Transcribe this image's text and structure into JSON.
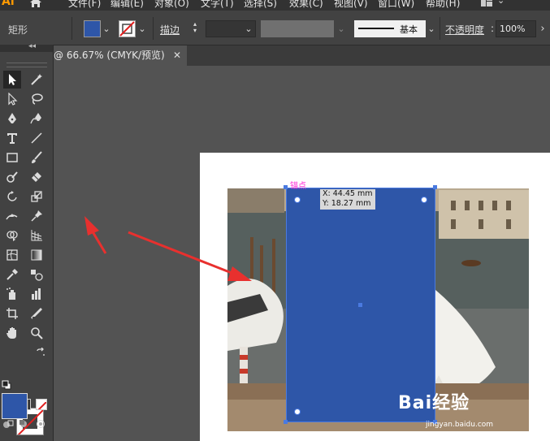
{
  "app": {
    "logo": "Ai"
  },
  "menu": [
    "文件(F)",
    "编辑(E)",
    "对象(O)",
    "文字(T)",
    "选择(S)",
    "效果(C)",
    "视图(V)",
    "窗口(W)",
    "帮助(H)"
  ],
  "control_bar": {
    "tool_name": "矩形",
    "fill_color": "#2e56a8",
    "stroke_label": "描边",
    "stroke_style": "基本",
    "opacity_label": "不透明度",
    "opacity_value": "100%"
  },
  "document_tab": {
    "title": "@ 66.67% (CMYK/预览)",
    "close": "✕"
  },
  "canvas": {
    "anchor_label": "锚点",
    "tooltip_x": "X: 44.45 mm",
    "tooltip_y": "Y: 18.27 mm",
    "rect_color": "#2e56a8",
    "annotation_color": "#e8302e"
  },
  "watermark": {
    "text": "Bai经验",
    "sub": "jingyan.baidu.com"
  }
}
